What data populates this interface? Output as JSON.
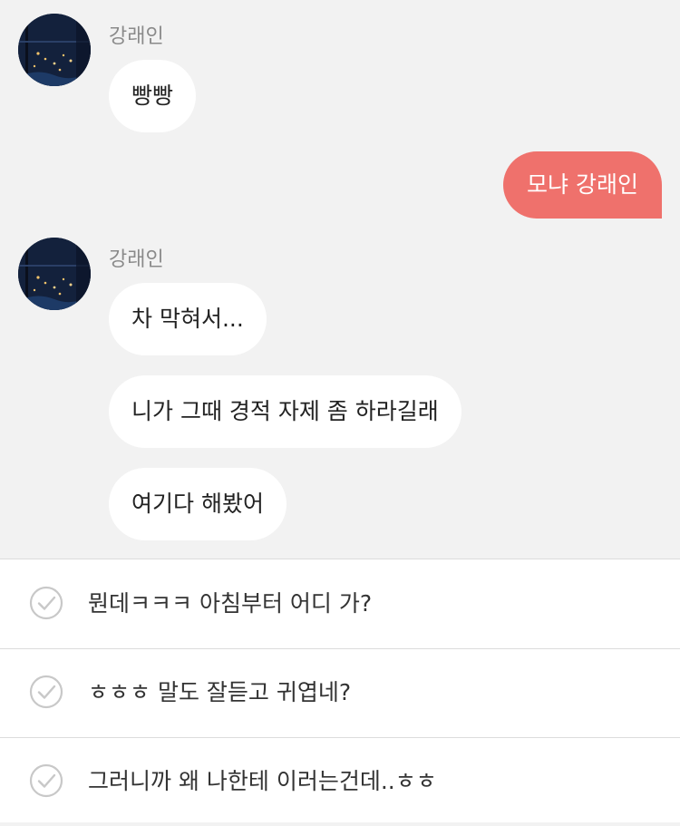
{
  "messages": {
    "m1": {
      "sender": "강래인",
      "text": "빵빵"
    },
    "m2": {
      "text": "모냐 강래인"
    },
    "m3": {
      "sender": "강래인",
      "lines": [
        "차 막혀서...",
        "니가 그때 경적 자제 좀 하라길래",
        "여기다 해봤어"
      ]
    }
  },
  "choices": [
    {
      "icon": "check-circle-icon",
      "text": "뭔데ㅋㅋㅋ 아침부터 어디 가?"
    },
    {
      "icon": "check-circle-icon",
      "text": "ㅎㅎㅎ 말도 잘듣고 귀엽네?"
    },
    {
      "icon": "check-circle-icon",
      "text": "그러니까 왜 나한테 이러는건데..ㅎㅎ"
    }
  ],
  "colors": {
    "outgoing_bubble": "#ef716c",
    "background": "#f2f2f2"
  }
}
